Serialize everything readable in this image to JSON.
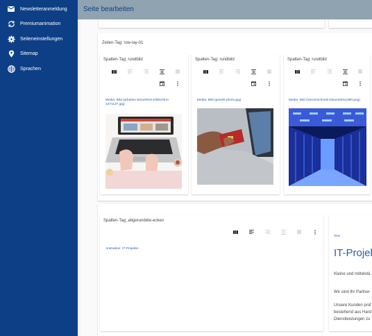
{
  "sidebar": {
    "items": [
      {
        "label": "Newsletteranmeldung",
        "icon": "mail-icon"
      },
      {
        "label": "Premiumanimation",
        "icon": "rotate-icon"
      },
      {
        "label": "Seiteneinstellungen",
        "icon": "gear-icon"
      },
      {
        "label": "Sitemap",
        "icon": "location-pin-icon"
      },
      {
        "label": "Sprachen",
        "icon": "globe-icon"
      }
    ]
  },
  "header": {
    "title": "Seite bearbeiten"
  },
  "row1": {
    "label": "Zeilen-Tag: row-lay-01",
    "columns": [
      {
        "label": "Spalten-Tag: rundbild",
        "media": "Media: Bild (arbeiten-beruehren-bildschirm-1271137.jpg)"
      },
      {
        "label": "Spalten-Tag: rundbild",
        "media": "Media: Bild (pexels-photo.jpg)"
      },
      {
        "label": "Spalten-Tag: rundbild",
        "media": "Media: Bild (Serverschrank-blau1920x1080.png)"
      }
    ]
  },
  "row2": {
    "column": {
      "label": "Spalten-Tag: abgerundete-ecken",
      "animation": "Animation: IT-Projekte -"
    },
    "text_card": {
      "type_label": "Text",
      "heading": "IT-Projekt",
      "lines": [
        "Kleine und mittelstä",
        "Wir sind Ihr Partner",
        "Unsere Kunden prof",
        "bestehend aus Hard",
        "Dienstleistungen zu"
      ]
    }
  }
}
